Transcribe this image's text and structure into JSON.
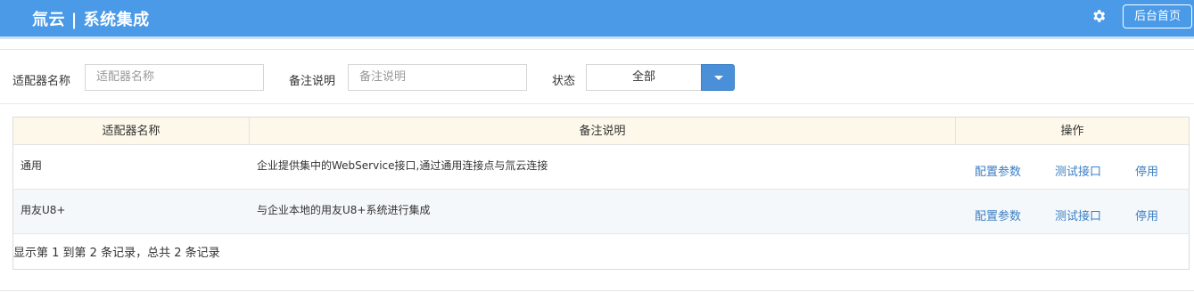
{
  "header": {
    "title": "氚云 | 系统集成",
    "settings_icon": "gear-icon",
    "home_button": "后台首页",
    "background_color": "#4a9ae8"
  },
  "filters": {
    "adapter_name_label": "适配器名称",
    "adapter_name_placeholder": "适配器名称",
    "remark_label": "备注说明",
    "remark_placeholder": "备注说明",
    "status_label": "状态",
    "status_value": "全部",
    "dropdown_icon": "caret-down-icon"
  },
  "table": {
    "columns": [
      "适配器名称",
      "备注说明",
      "操作"
    ],
    "rows": [
      {
        "name": "通用",
        "remark": "企业提供集中的WebService接口,通过通用连接点与氚云连接",
        "actions": [
          "配置参数",
          "测试接口",
          "停用"
        ]
      },
      {
        "name": "用友U8+",
        "remark": "与企业本地的用友U8+系统进行集成",
        "actions": [
          "配置参数",
          "测试接口",
          "停用"
        ]
      }
    ],
    "summary": "显示第 1 到第 2 条记录，总共 2 条记录",
    "action_color": "#3c7fc4",
    "header_color": "#fdf8ea"
  }
}
